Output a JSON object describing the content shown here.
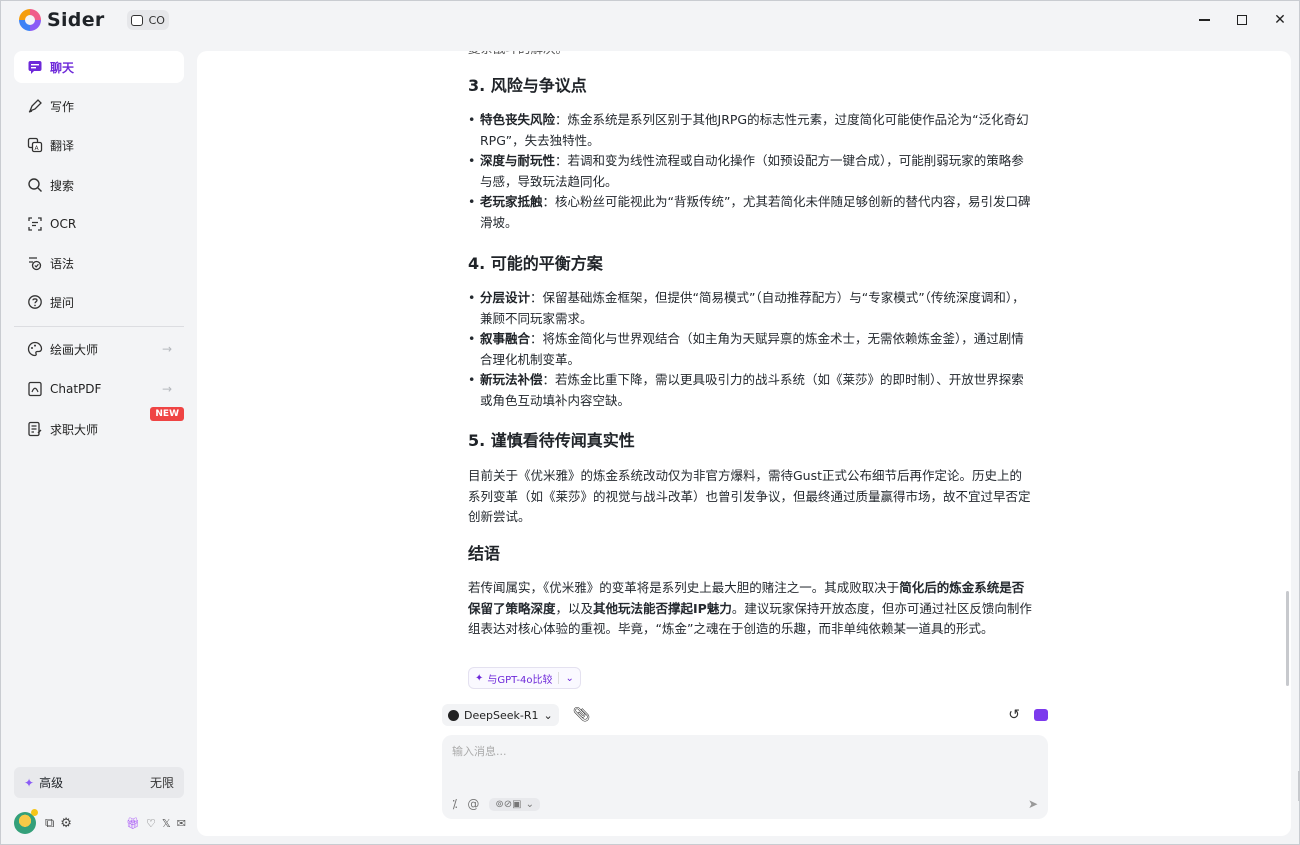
{
  "app": {
    "name": "Sider",
    "workspace_label": "CO"
  },
  "sidebar": {
    "items": [
      {
        "label": "聊天",
        "icon": "chat-icon"
      },
      {
        "label": "写作",
        "icon": "pen-icon"
      },
      {
        "label": "翻译",
        "icon": "translate-icon"
      },
      {
        "label": "搜索",
        "icon": "search-icon"
      },
      {
        "label": "OCR",
        "icon": "ocr-scan-icon"
      },
      {
        "label": "语法",
        "icon": "grammar-icon"
      },
      {
        "label": "提问",
        "icon": "question-icon"
      }
    ],
    "tools": [
      {
        "label": "绘画大师",
        "icon": "palette-icon"
      },
      {
        "label": "ChatPDF",
        "icon": "pdf-icon"
      },
      {
        "label": "求职大师",
        "icon": "resume-icon",
        "badge": "NEW"
      }
    ],
    "plan": {
      "label": "高级",
      "value": "无限"
    }
  },
  "content": {
    "clipped_text": "复杂战斗的解决。",
    "section3": {
      "heading": "3. 风险与争议点",
      "bullets": [
        {
          "term": "特色丧失风险",
          "text": "：炼金系统是系列区别于其他JRPG的标志性元素，过度简化可能使作品沦为“泛化奇幻RPG”，失去独特性。"
        },
        {
          "term": "深度与耐玩性",
          "text": "：若调和变为线性流程或自动化操作（如预设配方一键合成），可能削弱玩家的策略参与感，导致玩法趋同化。"
        },
        {
          "term": "老玩家抵触",
          "text": "：核心粉丝可能视此为“背叛传统”，尤其若简化未伴随足够创新的替代内容，易引发口碑滑坡。"
        }
      ]
    },
    "section4": {
      "heading": "4. 可能的平衡方案",
      "bullets": [
        {
          "term": "分层设计",
          "text": "：保留基础炼金框架，但提供“简易模式”（自动推荐配方）与“专家模式”（传统深度调和），兼顾不同玩家需求。"
        },
        {
          "term": "叙事融合",
          "text": "：将炼金简化与世界观结合（如主角为天赋异禀的炼金术士，无需依赖炼金釜），通过剧情合理化机制变革。"
        },
        {
          "term": "新玩法补偿",
          "text": "：若炼金比重下降，需以更具吸引力的战斗系统（如《莱莎》的即时制）、开放世界探索或角色互动填补内容空缺。"
        }
      ]
    },
    "section5": {
      "heading": "5. 谨慎看待传闻真实性",
      "paragraph": "目前关于《优米雅》的炼金系统改动仅为非官方爆料，需待Gust正式公布细节后再作定论。历史上的系列变革（如《莱莎》的视觉与战斗改革）也曾引发争议，但最终通过质量赢得市场，故不宜过早否定创新尝试。"
    },
    "conclusion": {
      "heading": "结语",
      "p1": "若传闻属实，《优米雅》的变革将是系列史上最大胆的赌注之一。其成败取决于",
      "b1": "简化后的炼金系统是否保留了策略深度",
      "p2": "，以及",
      "b2": "其他玩法能否撑起IP魅力",
      "p3": "。建议玩家保持开放态度，但亦可通过社区反馈向制作组表达对核心体验的重视。毕竟，“炼金”之魂在于创造的乐趣，而非单纯依赖某一道具的形式。"
    },
    "compare_label": "与GPT-4o比较"
  },
  "composer": {
    "model": "DeepSeek-R1",
    "placeholder": "输入消息..."
  }
}
